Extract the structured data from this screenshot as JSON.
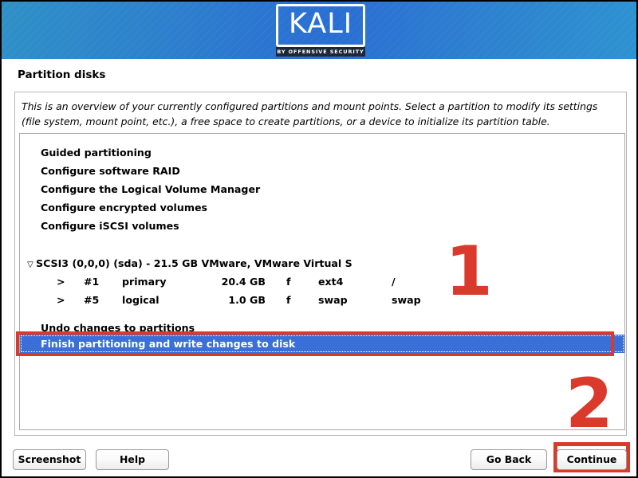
{
  "banner": {
    "logo_word": "KALI",
    "logo_tagline": "BY OFFENSIVE SECURITY",
    "gradient_left": "#2f90c6",
    "gradient_mid": "#2a6ed4",
    "gradient_right": "#2e93d0"
  },
  "page": {
    "title": "Partition disks",
    "description": "This is an overview of your currently configured partitions and mount points. Select a partition to modify its settings (file system, mount point, etc.), a free space to create partitions, or a device to initialize its partition table."
  },
  "list": {
    "menu_items": [
      "Guided partitioning",
      "Configure software RAID",
      "Configure the Logical Volume Manager",
      "Configure encrypted volumes",
      "Configure iSCSI volumes"
    ],
    "disk": {
      "disclosure_icon": "▽",
      "label": "SCSI3 (0,0,0) (sda) - 21.5 GB VMware, VMware Virtual S"
    },
    "partitions": [
      {
        "marker": ">",
        "number": "#1",
        "type": "primary",
        "size": "20.4 GB",
        "flag": "f",
        "filesystem": "ext4",
        "mountpoint": "/"
      },
      {
        "marker": ">",
        "number": "#5",
        "type": "logical",
        "size": "1.0 GB",
        "flag": "f",
        "filesystem": "swap",
        "mountpoint": "swap"
      }
    ],
    "undo_item": "Undo changes to partitions",
    "selected_item": "Finish partitioning and write changes to disk",
    "selection_color": "#3a6fd8"
  },
  "annotations": {
    "color": "#d93a2b",
    "step_one": "1",
    "step_two": "2"
  },
  "buttons": {
    "screenshot": "Screenshot",
    "help": "Help",
    "go_back": "Go Back",
    "continue": "Continue"
  }
}
